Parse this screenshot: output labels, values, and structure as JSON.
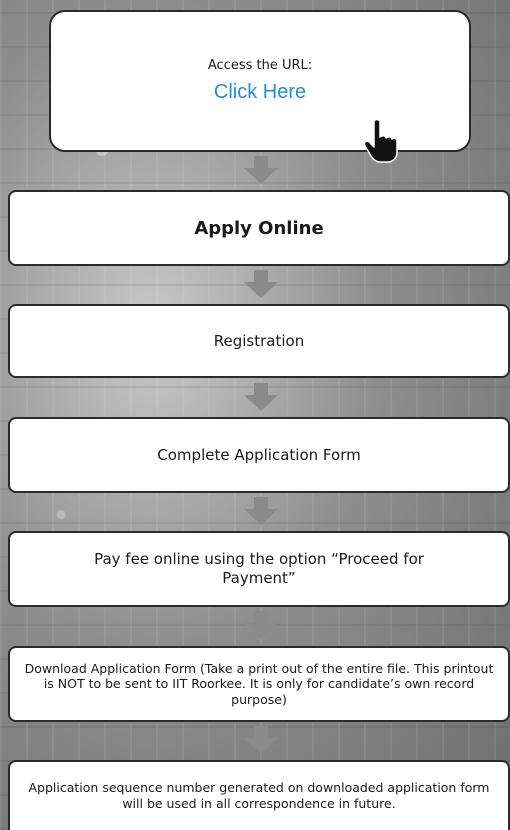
{
  "steps": {
    "access": {
      "caption": "Access the URL:",
      "link_text": "Click Here"
    },
    "apply": "Apply Online",
    "registration": "Registration",
    "complete_form": "Complete Application Form",
    "pay_fee": "Pay fee online using the option “Proceed for Payment”",
    "download": "Download Application Form (Take a print out of the entire file. This printout is NOT to be sent to IIT Roorkee. It is only for candidate’s own record purpose)",
    "sequence": "Application sequence number generated on downloaded application form will be used in all correspondence in future."
  },
  "colors": {
    "link": "#1e8fd9",
    "arrow": "#8a8a8a",
    "border": "#2b2b2b"
  },
  "icons": {
    "pointer": "hand-pointer-icon",
    "arrow": "down-arrow-icon"
  }
}
